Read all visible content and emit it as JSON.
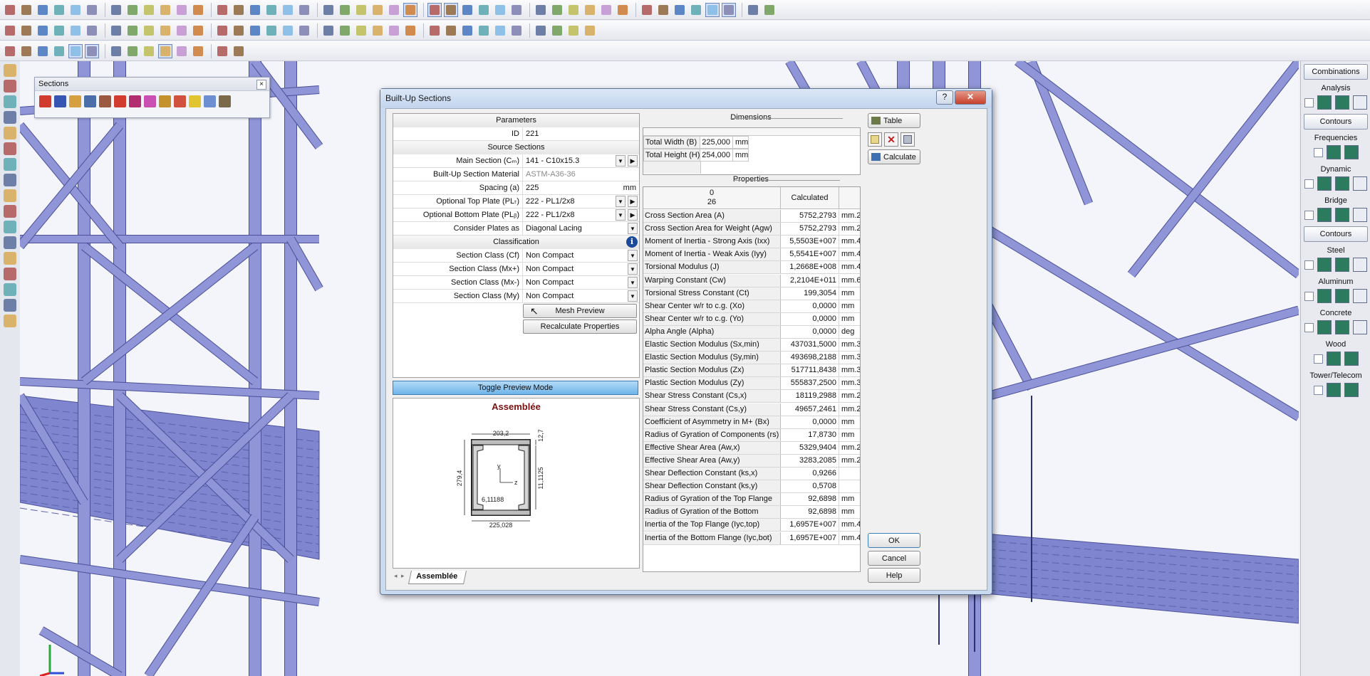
{
  "toolbars": {
    "row1_count": 44,
    "row2_count": 34,
    "row3_count": 14
  },
  "sections_palette": {
    "title": "Sections",
    "close": "×"
  },
  "dialog": {
    "title": "Built-Up Sections",
    "help_btn": "?",
    "close_btn": "✕",
    "params": {
      "header": "Parameters",
      "rows": [
        {
          "label": "ID",
          "value": "221",
          "type": "text"
        },
        {
          "header": "Source Sections"
        },
        {
          "label": "Main Section (Cₘ)",
          "value": "141 - C10x15.3",
          "type": "dropdown-arrow"
        },
        {
          "label": "Built-Up Section Material",
          "value": "ASTM-A36-36",
          "type": "readonly"
        },
        {
          "label": "Spacing (a)",
          "value": "225",
          "unit": "mm",
          "type": "unit"
        },
        {
          "label": "Optional Top Plate (PLₜ)",
          "value": "222 - PL1/2x8",
          "type": "dropdown-arrow"
        },
        {
          "label": "Optional Bottom Plate (PLᵦ)",
          "value": "222 - PL1/2x8",
          "type": "dropdown-arrow"
        },
        {
          "label": "Consider Plates as",
          "value": "Diagonal Lacing",
          "type": "dropdown"
        },
        {
          "header": "Classification",
          "info": true
        },
        {
          "label": "Section Class (Cf)",
          "value": "Non Compact",
          "type": "dropdown"
        },
        {
          "label": "Section Class (Mx+)",
          "value": "Non Compact",
          "type": "dropdown"
        },
        {
          "label": "Section Class (Mx-)",
          "value": "Non Compact",
          "type": "dropdown"
        },
        {
          "label": "Section Class (My)",
          "value": "Non Compact",
          "type": "dropdown"
        }
      ],
      "mesh_preview": "Mesh Preview",
      "recalculate": "Recalculate Properties"
    },
    "toggle_preview": "Toggle Preview Mode",
    "preview": {
      "title": "Assemblée",
      "dim_top": "203,2",
      "dim_right_top": "12,7",
      "dim_right": "11,1125",
      "dim_left": "279,4",
      "dim_inner": "6,11188",
      "dim_bottom": "225,028",
      "axis_y": "y",
      "axis_z": "z"
    },
    "tab": "Assemblée",
    "dimensions": {
      "header": "Dimensions",
      "rows": [
        {
          "label": "Total Width (B)",
          "value": "225,000",
          "unit": "mm"
        },
        {
          "label": "Total Height (H)",
          "value": "254,000",
          "unit": "mm"
        }
      ]
    },
    "properties": {
      "header": "Properties",
      "col_top": "0",
      "col_bottom": "26",
      "col_calc": "Calculated",
      "rows": [
        {
          "label": "Cross Section Area (A)",
          "value": "5752,2793",
          "unit": "mm.2"
        },
        {
          "label": "Cross Section Area for Weight (Agw)",
          "value": "5752,2793",
          "unit": "mm.2"
        },
        {
          "label": "Moment of Inertia - Strong Axis (Ixx)",
          "value": "5,5503E+007",
          "unit": "mm.4"
        },
        {
          "label": "Moment of Inertia - Weak Axis (Iyy)",
          "value": "5,5541E+007",
          "unit": "mm.4"
        },
        {
          "label": "Torsional Modulus (J)",
          "value": "1,2668E+008",
          "unit": "mm.4"
        },
        {
          "label": "Warping Constant (Cw)",
          "value": "2,2104E+011",
          "unit": "mm.6"
        },
        {
          "label": "Torsional Stress Constant (Ct)",
          "value": "199,3054",
          "unit": "mm"
        },
        {
          "label": "Shear Center w/r to c.g. (Xo)",
          "value": "0,0000",
          "unit": "mm"
        },
        {
          "label": "Shear Center w/r to c.g. (Yo)",
          "value": "0,0000",
          "unit": "mm"
        },
        {
          "label": "Alpha Angle (Alpha)",
          "value": "0,0000",
          "unit": "deg"
        },
        {
          "label": "Elastic Section Modulus (Sx,min)",
          "value": "437031,5000",
          "unit": "mm.3"
        },
        {
          "label": "Elastic Section Modulus (Sy,min)",
          "value": "493698,2188",
          "unit": "mm.3"
        },
        {
          "label": "Plastic Section Modulus (Zx)",
          "value": "517711,8438",
          "unit": "mm.3"
        },
        {
          "label": "Plastic Section Modulus (Zy)",
          "value": "555837,2500",
          "unit": "mm.3"
        },
        {
          "label": "Shear Stress Constant (Cs,x)",
          "value": "18119,2988",
          "unit": "mm.2"
        },
        {
          "label": "Shear Stress Constant (Cs,y)",
          "value": "49657,2461",
          "unit": "mm.2"
        },
        {
          "label": "Coefficient of Asymmetry in M+ (Bx)",
          "value": "0,0000",
          "unit": "mm"
        },
        {
          "label": "Radius of Gyration of Components (rs)",
          "value": "17,8730",
          "unit": "mm"
        },
        {
          "label": "Effective Shear Area (Aw,x)",
          "value": "5329,9404",
          "unit": "mm.2"
        },
        {
          "label": "Effective Shear Area (Aw,y)",
          "value": "3283,2085",
          "unit": "mm.2"
        },
        {
          "label": "Shear Deflection Constant (ks,x)",
          "value": "0,9266",
          "unit": ""
        },
        {
          "label": "Shear Deflection Constant (ks,y)",
          "value": "0,5708",
          "unit": ""
        },
        {
          "label": "Radius of Gyration of the Top Flange (rt,top)",
          "value": "92,6898",
          "unit": "mm"
        },
        {
          "label": "Radius of Gyration of the Bottom Flange (rt,bot)",
          "value": "92,6898",
          "unit": "mm"
        },
        {
          "label": "Inertia of the Top Flange (Iyc,top)",
          "value": "1,6957E+007",
          "unit": "mm.4"
        },
        {
          "label": "Inertia of the Bottom Flange (Iyc,bot)",
          "value": "1,6957E+007",
          "unit": "mm.4"
        }
      ]
    },
    "buttons": {
      "table": "Table",
      "calculate": "Calculate",
      "ok": "OK",
      "cancel": "Cancel",
      "help": "Help"
    }
  },
  "right_panel": {
    "items": [
      {
        "kind": "button",
        "label": "Combinations"
      },
      {
        "kind": "label",
        "label": "Analysis",
        "icons": 3
      },
      {
        "kind": "button",
        "label": "Contours"
      },
      {
        "kind": "label",
        "label": "Frequencies",
        "icons": 2
      },
      {
        "kind": "label",
        "label": "Dynamic",
        "icons": 3
      },
      {
        "kind": "label",
        "label": "Bridge",
        "icons": 3
      },
      {
        "kind": "button",
        "label": "Contours"
      },
      {
        "kind": "label",
        "label": "Steel",
        "icons": 3
      },
      {
        "kind": "label",
        "label": "Aluminum",
        "icons": 3
      },
      {
        "kind": "label",
        "label": "Concrete",
        "icons": 3
      },
      {
        "kind": "label",
        "label": "Wood",
        "icons": 2
      },
      {
        "kind": "label",
        "label": "Tower/Telecom",
        "icons": 2
      }
    ]
  },
  "colors": {
    "steel_member": "#8f95d6",
    "steel_dark": "#4a4f9a",
    "dialog_frame": "#c9d9ee",
    "toggle_blue": "#6eb5ea",
    "preview_title": "#7a0f0f"
  }
}
